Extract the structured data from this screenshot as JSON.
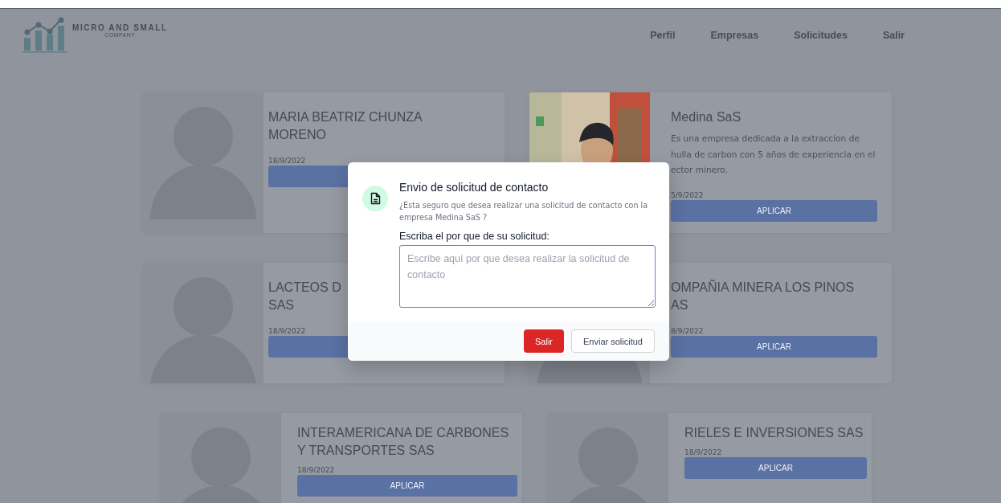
{
  "navbar": {
    "brand": "MICRO AND SMALL",
    "brand_subtitle": "COMPANY",
    "links": [
      "Perfil",
      "Empresas",
      "Solicitudes",
      "Salir"
    ]
  },
  "cards": [
    {
      "kind": "avatar",
      "title": "MARIA BEATRIZ CHUNZA\nMORENO",
      "date": "18/9/2022"
    },
    {
      "kind": "picture",
      "title": "Medina SaS",
      "description": "Es una empresa dedicada a la extraccion de\nhulla de carbon con 5 años de experiencia en el\nector minero.",
      "date": "5/9/2022",
      "button": "APLICAR"
    },
    {
      "kind": "avatar",
      "title": "LACTEOS D\nSAS",
      "date": "18/9/2022"
    },
    {
      "kind": "avatar",
      "title": "OMPAÑIA MINERA LOS PINOS\nAS",
      "date": "8/9/2022",
      "button": "APLICAR"
    },
    {
      "kind": "avatar",
      "title": "INTERAMERICANA DE CARBONES\nY TRANSPORTES SAS",
      "date": "18/9/2022",
      "button": "APLICAR"
    },
    {
      "kind": "avatar",
      "title": "RIELES E INVERSIONES SAS",
      "date": "18/9/2022",
      "button": "APLICAR"
    }
  ],
  "modal": {
    "title": "Envio de solicitud de contacto",
    "message": "¿Esta seguro que desea realizar una solicitud de contacto con la empresa Medina SaS ?",
    "field_label": "Escriba el por que de su solicitud:",
    "placeholder": "Escribe aquí por que desea realizar la solicitud de contacto",
    "buttons": [
      "Salir",
      "Enviar solicitud"
    ]
  }
}
